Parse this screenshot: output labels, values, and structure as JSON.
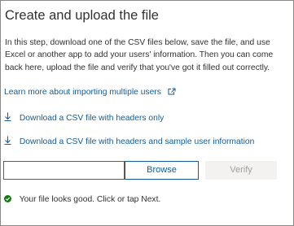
{
  "panel": {
    "title": "Create and upload the file",
    "description": "In this step, download one of the CSV files below, save the file, and use Excel or another app to add your users' information. Then you can come back here, upload the file and verify that you've got it filled out correctly."
  },
  "links": {
    "learn_more": "Learn more about importing multiple users",
    "download_headers": "Download a CSV file with headers only",
    "download_sample": "Download a CSV file with headers and sample user information"
  },
  "upload": {
    "file_value": "",
    "browse_label": "Browse",
    "verify_label": "Verify"
  },
  "status": {
    "message": "Your file looks good. Click or tap Next."
  },
  "colors": {
    "link": "#0f5c99",
    "success": "#107c10",
    "text": "#323130",
    "disabled_bg": "#f3f2f1",
    "disabled_text": "#a19f9d"
  },
  "icons": {
    "external_link": "open-in-new-window-icon",
    "download": "download-arrow-icon",
    "success": "checkmark-circle-icon"
  }
}
